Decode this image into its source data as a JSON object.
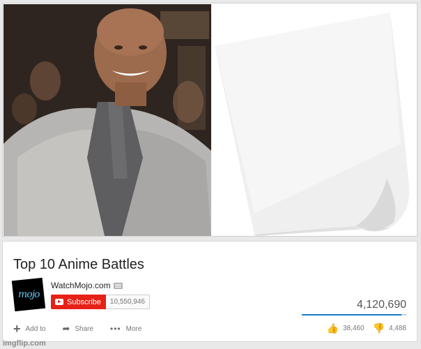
{
  "video": {
    "title": "Top 10 Anime Battles",
    "channel": "WatchMojo.com",
    "logo_text": "mojo",
    "subscribe_label": "Subscribe",
    "subscriber_count": "10,550,946",
    "views": "4,120,690",
    "view_bar_fraction": 0.95
  },
  "actions": {
    "add_label": "Add to",
    "share_label": "Share",
    "more_label": "More",
    "likes": "38,460",
    "dislikes": "4,488"
  },
  "watermark": "imgflip.com",
  "icons": [
    "plus-icon",
    "share-arrow-icon",
    "more-dots-icon",
    "thumbs-up-icon",
    "thumbs-down-icon",
    "youtube-play-icon",
    "verified-icon"
  ],
  "colors": {
    "subscribe_red": "#e62117",
    "view_bar_blue": "#167ac6"
  }
}
